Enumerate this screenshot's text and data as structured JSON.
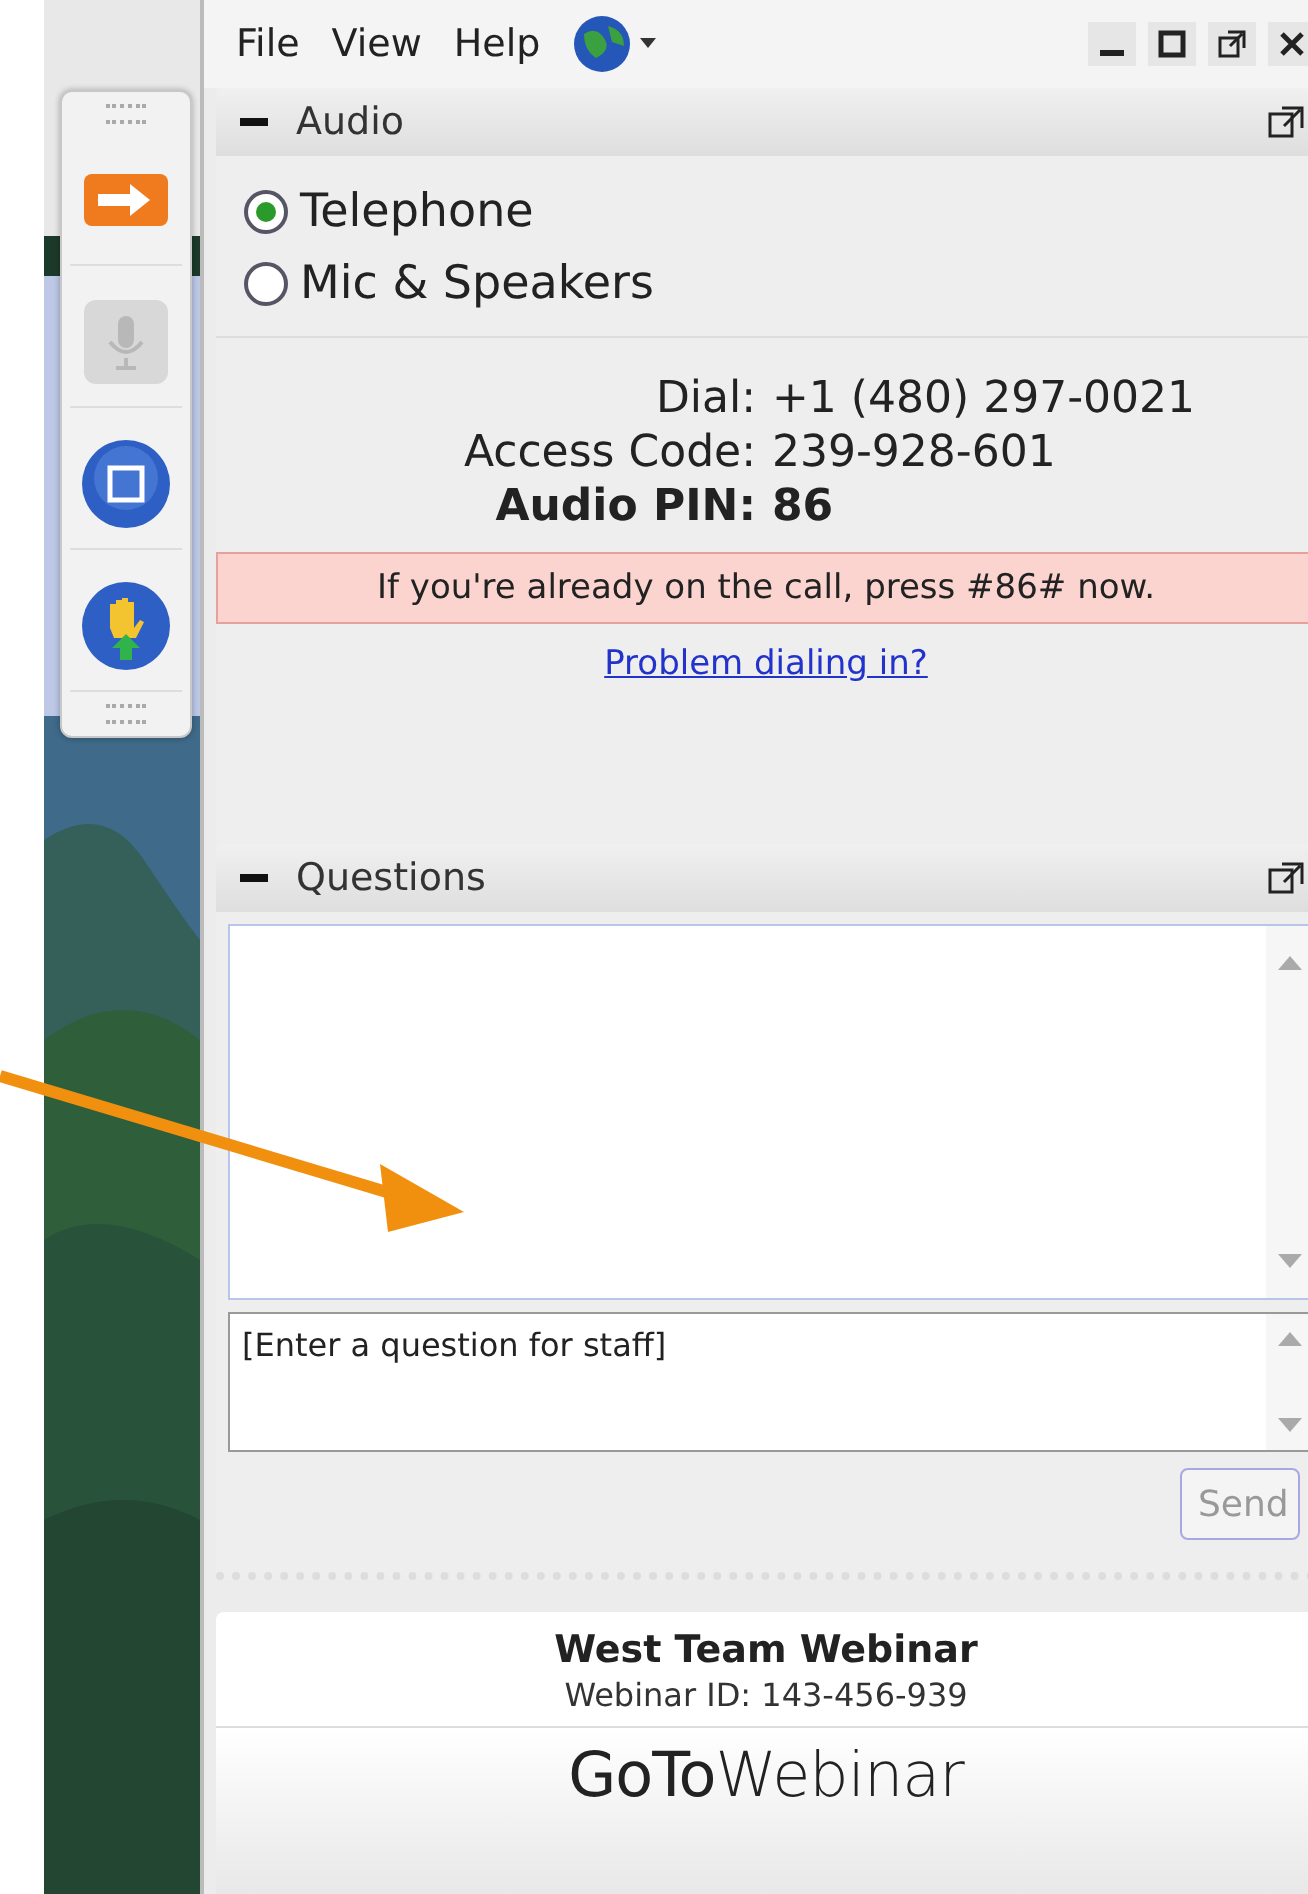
{
  "toolbar": [
    {
      "kind": "arrow",
      "disabled": false
    },
    {
      "kind": "mic",
      "disabled": true
    },
    {
      "kind": "screen",
      "disabled": false
    },
    {
      "kind": "hand",
      "disabled": false
    }
  ],
  "menu": [
    {
      "label": "File"
    },
    {
      "label": "View"
    },
    {
      "label": "Help"
    }
  ],
  "audio": {
    "title": "Audio",
    "options": [
      {
        "label": "Telephone",
        "selected": true
      },
      {
        "label": "Mic & Speakers",
        "selected": false
      }
    ],
    "details": [
      {
        "label": "Dial:",
        "value": "+1 (480) 297-0021",
        "emphasis": false
      },
      {
        "label": "Access Code:",
        "value": "239-928-601",
        "emphasis": false
      },
      {
        "label": "Audio PIN:",
        "value": "86",
        "emphasis": true
      }
    ],
    "notice": "If you're already on the call, press #86# now.",
    "link": "Problem dialing in?"
  },
  "questions": {
    "title": "Questions",
    "input": {
      "placeholder": "[Enter a question for staff]"
    },
    "send": "Send"
  },
  "webinar": {
    "title": "West Team Webinar",
    "id": "Webinar ID: 143-456-939"
  },
  "logo": "**GoTo**Webinar"
}
